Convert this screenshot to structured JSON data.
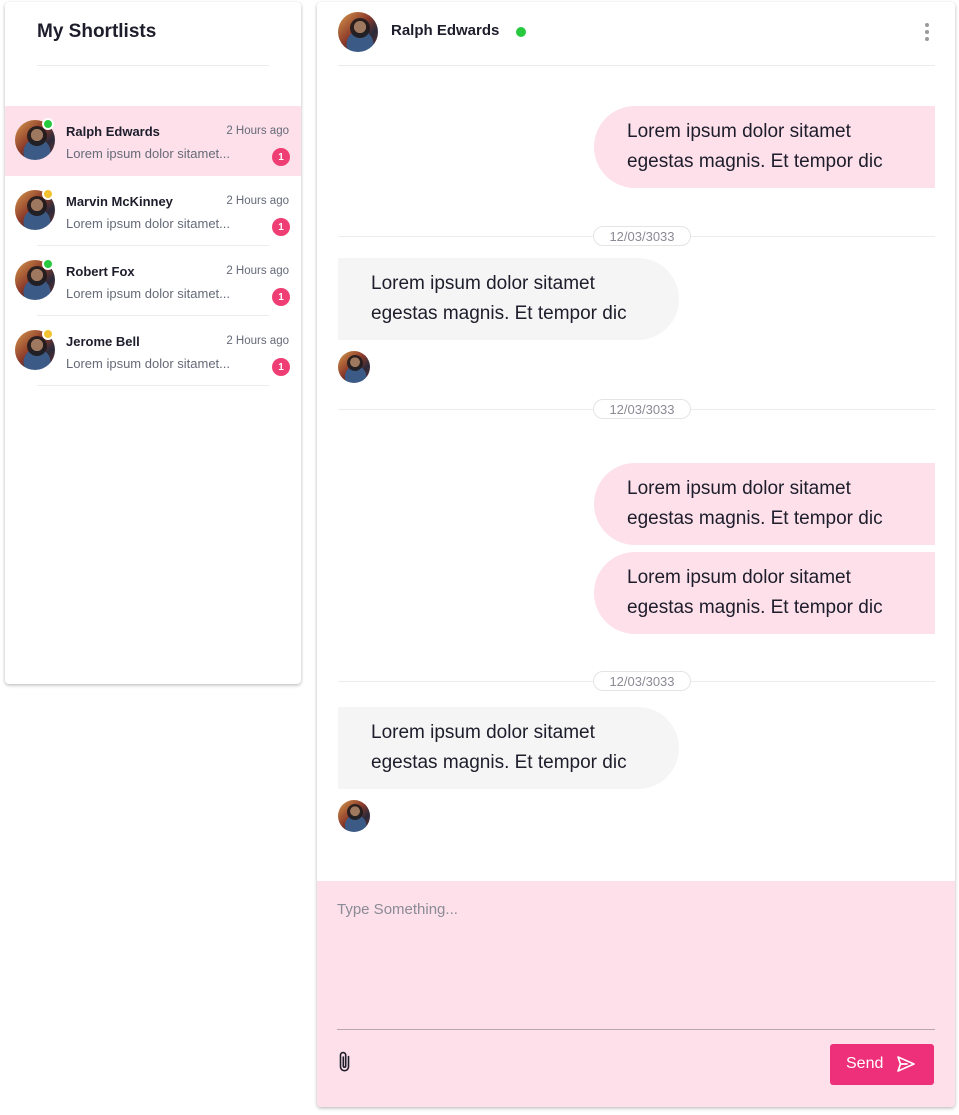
{
  "sidebar": {
    "title": "My Shortlists",
    "contacts": [
      {
        "name": "Ralph Edwards",
        "time": "2 Hours ago",
        "preview": "Lorem ipsum dolor sitamet...",
        "unread": "1",
        "status": "online",
        "active": true
      },
      {
        "name": "Marvin McKinney",
        "time": "2 Hours ago",
        "preview": "Lorem ipsum dolor sitamet...",
        "unread": "1",
        "status": "away",
        "active": false
      },
      {
        "name": "Robert Fox",
        "time": "2 Hours ago",
        "preview": "Lorem ipsum dolor sitamet...",
        "unread": "1",
        "status": "online",
        "active": false
      },
      {
        "name": "Jerome Bell",
        "time": "2 Hours ago",
        "preview": "Lorem ipsum dolor sitamet...",
        "unread": "1",
        "status": "away",
        "active": false
      }
    ]
  },
  "chat": {
    "header": {
      "name": "Ralph Edwards",
      "status": "online",
      "menu_icon": "more-vertical-icon"
    },
    "messages": [
      {
        "type": "sent",
        "text": "Lorem ipsum dolor sitamet egestas magnis. Et tempor dic"
      },
      {
        "type": "date",
        "text": "12/03/3033"
      },
      {
        "type": "received",
        "text": "Lorem ipsum dolor sitamet egestas magnis. Et tempor dic"
      },
      {
        "type": "date",
        "text": "12/03/3033"
      },
      {
        "type": "sent",
        "text": "Lorem ipsum dolor sitamet egestas magnis. Et tempor dic"
      },
      {
        "type": "sent",
        "text": "Lorem ipsum dolor sitamet egestas magnis. Et tempor dic"
      },
      {
        "type": "date",
        "text": "12/03/3033"
      },
      {
        "type": "received",
        "text": "Lorem ipsum dolor sitamet egestas magnis. Et tempor dic"
      }
    ]
  },
  "composer": {
    "placeholder": "Type Something...",
    "attach_icon": "paperclip-icon",
    "send_label": "Send",
    "send_icon": "send-icon"
  },
  "colors": {
    "accent": "#ee2f7a",
    "sent_bubble": "#fde0ea",
    "received_bubble": "#f5f5f5",
    "badge": "#ef3e74",
    "online": "#27c93f",
    "away": "#f2c230"
  }
}
